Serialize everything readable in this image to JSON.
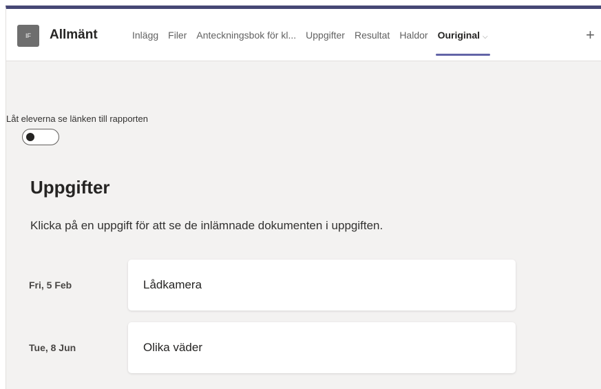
{
  "header": {
    "team_initials": "IF",
    "channel_name": "Allmänt",
    "tabs": [
      {
        "label": "Inlägg",
        "active": false
      },
      {
        "label": "Filer",
        "active": false
      },
      {
        "label": "Anteckningsbok för kl...",
        "active": false
      },
      {
        "label": "Uppgifter",
        "active": false
      },
      {
        "label": "Resultat",
        "active": false
      },
      {
        "label": "Haldor",
        "active": false
      },
      {
        "label": "Ouriginal",
        "active": true
      }
    ],
    "active_tab_chevron": "⌵",
    "add_tab_symbol": "+"
  },
  "settings": {
    "toggle_label": "Låt eleverna se länken till rapporten",
    "toggle_on": false
  },
  "main": {
    "title": "Uppgifter",
    "description": "Klicka på en uppgift för att se de inlämnade dokumenten i uppgiften.",
    "assignments": [
      {
        "date": "Fri, 5 Feb",
        "name": "Lådkamera"
      },
      {
        "date": "Tue, 8 Jun",
        "name": "Olika väder"
      }
    ]
  },
  "colors": {
    "accent": "#6264a7",
    "top_bar": "#464775",
    "background": "#f3f2f1"
  }
}
